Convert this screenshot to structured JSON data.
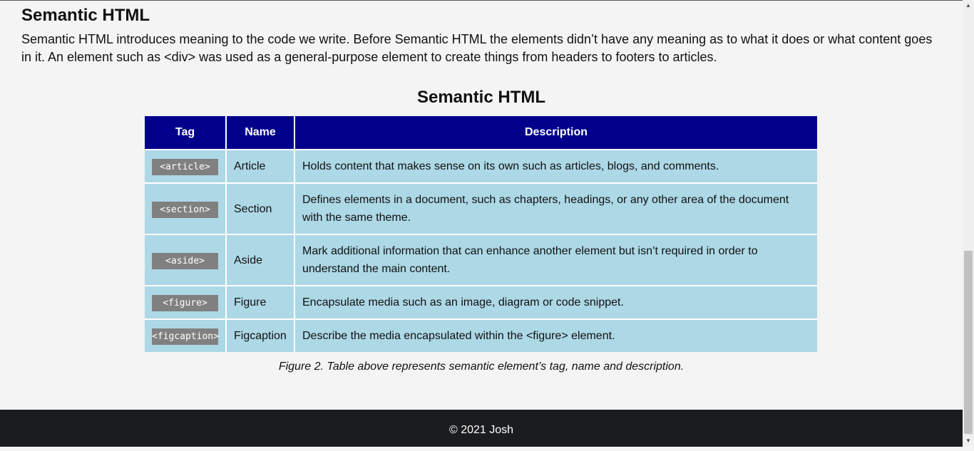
{
  "section": {
    "title": "Semantic HTML",
    "intro": "Semantic HTML introduces meaning to the code we write. Before Semantic HTML the elements didn’t have any meaning as to what it does or what content goes in it. An element such as <div> was used as a general-purpose element to create things from headers to footers to articles."
  },
  "table": {
    "title": "Semantic HTML",
    "headers": [
      "Tag",
      "Name",
      "Description"
    ],
    "rows": [
      {
        "tag": "<article>",
        "name": "Article",
        "description": "Holds content that makes sense on its own such as articles, blogs, and comments."
      },
      {
        "tag": "<section>",
        "name": "Section",
        "description": "Defines elements in a document, such as chapters, headings, or any other area of the document with the same theme."
      },
      {
        "tag": "<aside>",
        "name": "Aside",
        "description": "Mark additional information that can enhance another element but isn’t required in order to understand the main content."
      },
      {
        "tag": "<figure>",
        "name": "Figure",
        "description": "Encapsulate media such as an image, diagram or code snippet."
      },
      {
        "tag": "<figcaption>",
        "name": "Figcaption",
        "description": "Describe the media encapsulated within the <figure> element."
      }
    ],
    "caption": "Figure 2. Table above represents semantic element’s tag, name and description."
  },
  "footer": {
    "text": "© 2021 Josh"
  },
  "colors": {
    "header_bg": "#00008b",
    "cell_bg": "#add8e6",
    "tag_bg": "#808080",
    "footer_bg": "#1b1c1e"
  }
}
